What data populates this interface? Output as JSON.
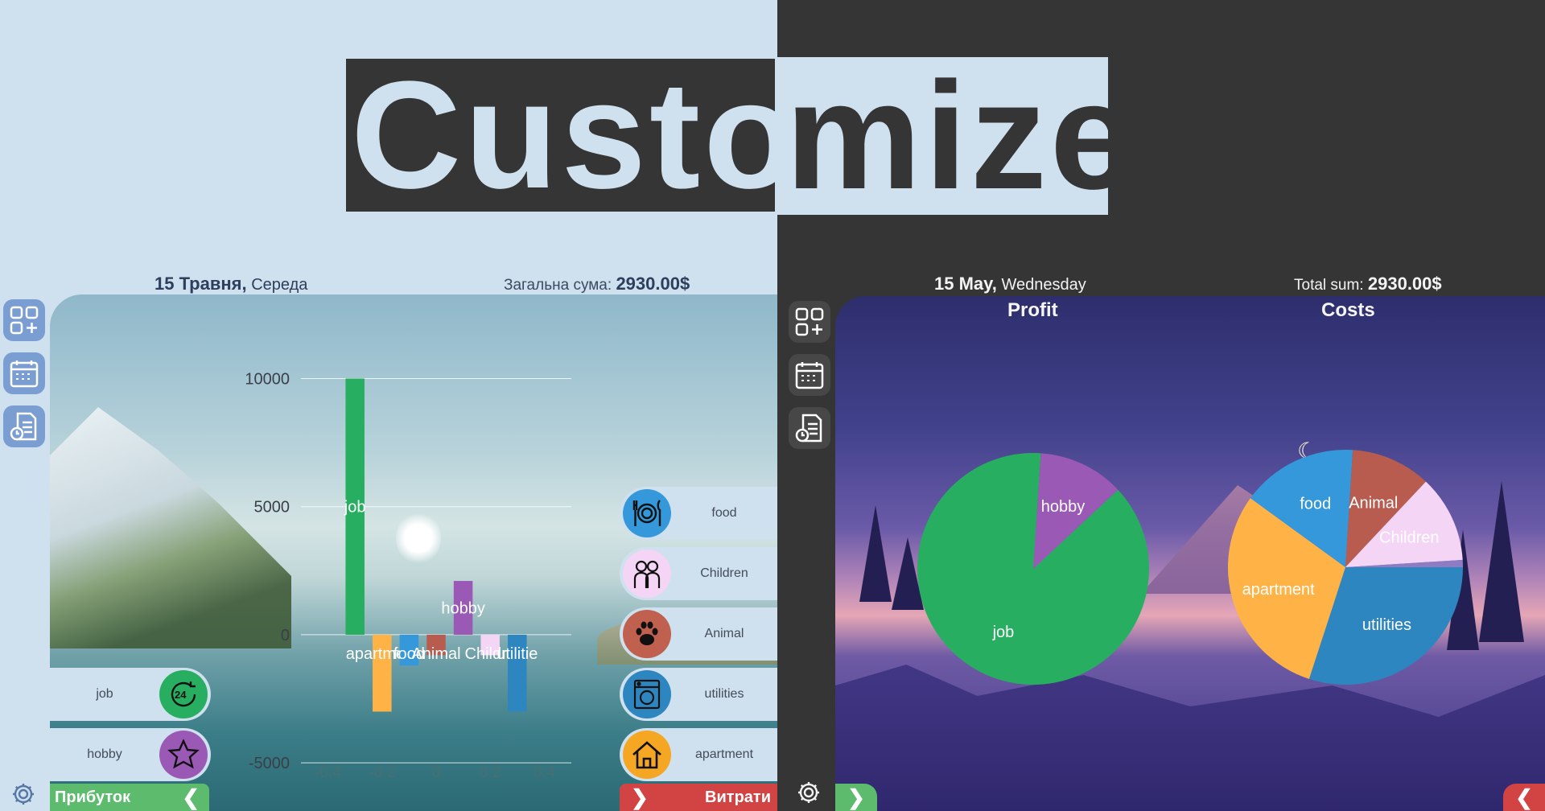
{
  "banner": {
    "left_text": "Custo",
    "right_text": "mize"
  },
  "left_panel": {
    "date_day": "15 Травня",
    "date_sep": ",",
    "date_weekday": "Середа",
    "sum_label": "Загальна сума:",
    "sum_value": "2930.00$",
    "income_items": [
      {
        "label": "job",
        "icon": "24-hours-icon",
        "color": "#27ae60"
      },
      {
        "label": "hobby",
        "icon": "star-icon",
        "color": "#9b59b6"
      }
    ],
    "expense_items": [
      {
        "label": "food",
        "icon": "plate-cutlery-icon",
        "color": "#3498db"
      },
      {
        "label": "Children",
        "icon": "children-icon",
        "color": "#f5d5f5"
      },
      {
        "label": "Animal",
        "icon": "paw-icon",
        "color": "#c0604e"
      },
      {
        "label": "utilities",
        "icon": "washing-machine-icon",
        "color": "#2e86c1"
      },
      {
        "label": "apartment",
        "icon": "house-icon",
        "color": "#f5a623"
      }
    ],
    "profit_label": "Прибуток",
    "profit_arrow": "❮",
    "costs_label": "Витрати",
    "costs_arrow": "❯"
  },
  "right_panel": {
    "date_day": "15 May",
    "date_sep": ",",
    "date_weekday": "Wednesday",
    "sum_label": "Total sum:",
    "sum_value": "2930.00$",
    "profit_arrow": "❯",
    "costs_arrow": "❮"
  },
  "chart_data": [
    {
      "type": "bar",
      "title": "",
      "xlabel": "",
      "ylabel": "",
      "x_ticks": [
        "-0.4",
        "-0.2",
        "0",
        "0.2",
        "0.4"
      ],
      "y_ticks": [
        "10000",
        "5000",
        "0",
        "-5000"
      ],
      "xlim": [
        -0.5,
        0.5
      ],
      "ylim": [
        -6000,
        10800
      ],
      "bars": [
        {
          "label": "job",
          "x": -0.3,
          "value": 10000,
          "color": "#27ae60"
        },
        {
          "label": "apartment",
          "x": -0.2,
          "value": -3000,
          "color": "#ffb347"
        },
        {
          "label": "food",
          "x": -0.1,
          "value": -1200,
          "color": "#3498db"
        },
        {
          "label": "Animal",
          "x": 0.0,
          "value": -800,
          "color": "#b85c50"
        },
        {
          "label": "hobby",
          "x": 0.1,
          "value": 2100,
          "color": "#9b59b6"
        },
        {
          "label": "Childre",
          "x": 0.2,
          "value": -800,
          "color": "#f5d5f5"
        },
        {
          "label": "utilitie",
          "x": 0.3,
          "value": -3000,
          "color": "#2e86c1"
        }
      ],
      "bar_width": 0.07
    },
    {
      "type": "pie",
      "title": "Profit",
      "slices": [
        {
          "label": "job",
          "value": 88,
          "color": "#27ae60"
        },
        {
          "label": "hobby",
          "value": 12,
          "color": "#9b59b6"
        }
      ]
    },
    {
      "type": "pie",
      "title": "Costs",
      "slices": [
        {
          "label": "utilities",
          "value": 30,
          "color": "#2e86c1"
        },
        {
          "label": "apartment",
          "value": 30,
          "color": "#ffb347"
        },
        {
          "label": "food",
          "value": 16,
          "color": "#3498db"
        },
        {
          "label": "Animal",
          "value": 11,
          "color": "#b85c50"
        },
        {
          "label": "Children",
          "value": 12,
          "color": "#f5d5f5"
        },
        {
          "label": "",
          "value": 1,
          "color": "#8e7cc3"
        }
      ]
    }
  ]
}
